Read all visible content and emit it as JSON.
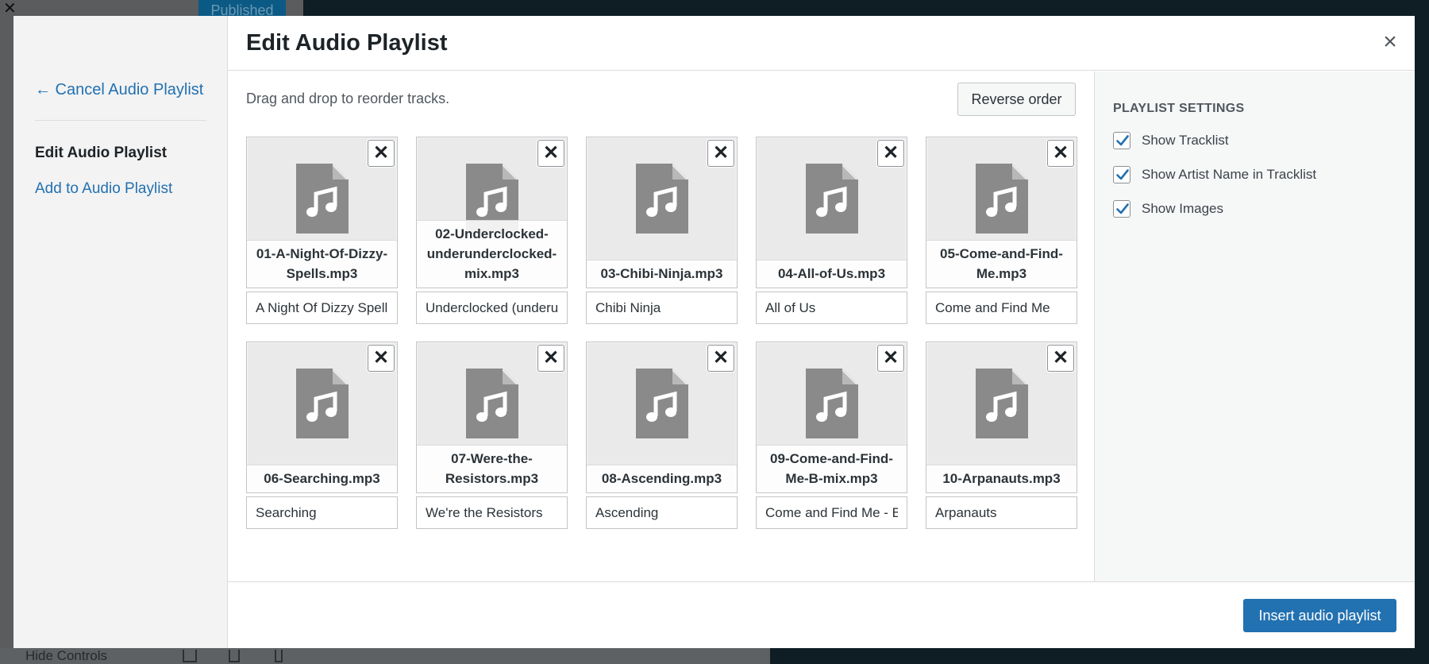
{
  "background": {
    "published_label": "Published",
    "footer_label": "Hide Controls"
  },
  "modal": {
    "title": "Edit Audio Playlist",
    "close_glyph": "×",
    "menu": {
      "cancel": "← Cancel Audio Playlist",
      "active": "Edit Audio Playlist",
      "add": "Add to Audio Playlist"
    },
    "instructions": "Drag and drop to reorder tracks.",
    "reverse_label": "Reverse order",
    "remove_glyph": "✕",
    "tracks": [
      {
        "filename": "01-A-Night-Of-Dizzy-Spells.mp3",
        "caption": "A Night Of Dizzy Spells"
      },
      {
        "filename": "02-Underclocked-underunderclocked-mix.mp3",
        "caption": "Underclocked (underunderclocked mix)"
      },
      {
        "filename": "03-Chibi-Ninja.mp3",
        "caption": "Chibi Ninja"
      },
      {
        "filename": "04-All-of-Us.mp3",
        "caption": "All of Us"
      },
      {
        "filename": "05-Come-and-Find-Me.mp3",
        "caption": "Come and Find Me"
      },
      {
        "filename": "06-Searching.mp3",
        "caption": "Searching"
      },
      {
        "filename": "07-Were-the-Resistors.mp3",
        "caption": "We're the Resistors"
      },
      {
        "filename": "08-Ascending.mp3",
        "caption": "Ascending"
      },
      {
        "filename": "09-Come-and-Find-Me-B-mix.mp3",
        "caption": "Come and Find Me - B mix"
      },
      {
        "filename": "10-Arpanauts.mp3",
        "caption": "Arpanauts"
      }
    ],
    "settings": {
      "heading": "PLAYLIST SETTINGS",
      "options": [
        {
          "label": "Show Tracklist",
          "checked": true
        },
        {
          "label": "Show Artist Name in Tracklist",
          "checked": true
        },
        {
          "label": "Show Images",
          "checked": true
        }
      ]
    },
    "insert_label": "Insert audio playlist"
  },
  "colors": {
    "accent": "#2271b1",
    "checkmark": "#2271b1",
    "file_icon": "#8a8a8a"
  },
  "icons": {
    "file_icon": "audio-file-icon",
    "remove_icon": "remove-icon",
    "close_icon": "close-icon",
    "check_icon": "checkmark-icon"
  }
}
